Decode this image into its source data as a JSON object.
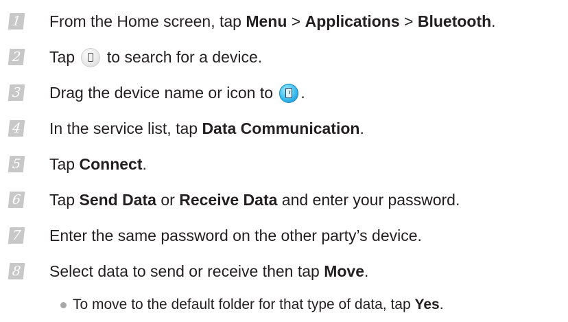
{
  "steps": [
    {
      "number": "1",
      "parts": {
        "p1": "From the Home screen, tap ",
        "b1": "Menu",
        "p2": " > ",
        "b2": "Applications",
        "p3": " > ",
        "b3": "Bluetooth",
        "p4": "."
      }
    },
    {
      "number": "2",
      "parts": {
        "p1": "Tap ",
        "icon": "search-device-icon",
        "p2": " to search for a device."
      }
    },
    {
      "number": "3",
      "parts": {
        "p1": "Drag the device name or icon to ",
        "icon": "bluetooth-device-icon",
        "p2": "."
      }
    },
    {
      "number": "4",
      "parts": {
        "p1": "In the service list, tap ",
        "b1": "Data Communication",
        "p2": "."
      }
    },
    {
      "number": "5",
      "parts": {
        "p1": "Tap ",
        "b1": "Connect",
        "p2": "."
      }
    },
    {
      "number": "6",
      "parts": {
        "p1": "Tap ",
        "b1": "Send Data",
        "p2": " or ",
        "b2": "Receive Data",
        "p3": " and enter your password."
      }
    },
    {
      "number": "7",
      "parts": {
        "p1": "Enter the same password on the other party’s device."
      }
    },
    {
      "number": "8",
      "parts": {
        "p1": "Select data to send or receive then tap ",
        "b1": "Move",
        "p2": "."
      }
    }
  ],
  "note": {
    "p1": "To move to the default folder for that type of data, tap ",
    "b1": "Yes",
    "p2": "."
  },
  "colors": {
    "text": "#231f20",
    "number_box": "#c8c8c8",
    "bullet": "#a8a8a8",
    "bluetooth_icon": "#35b9ea"
  }
}
